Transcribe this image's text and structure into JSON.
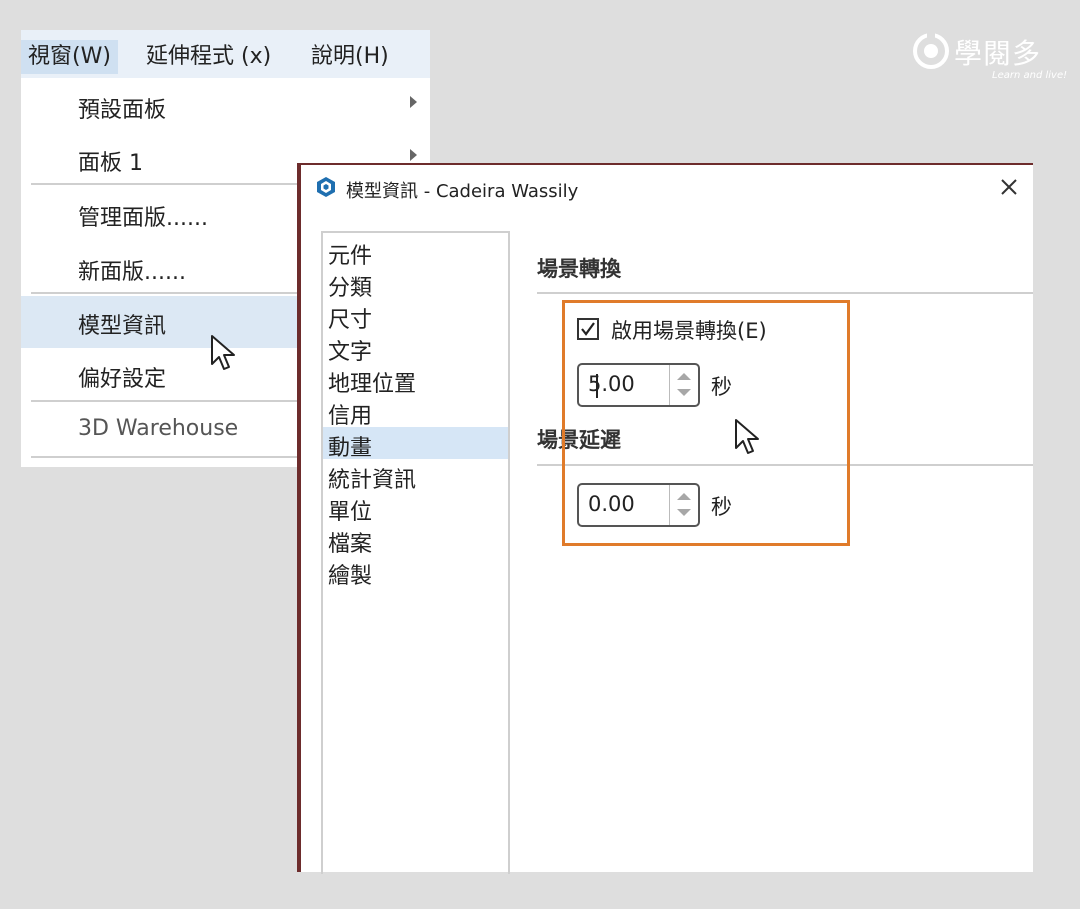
{
  "brand": {
    "name": "學閱多",
    "tagline": "Learn and live!"
  },
  "menubar": {
    "items": [
      "視窗(W)",
      "延伸程式 (x)",
      "說明(H)"
    ]
  },
  "dropdown": {
    "items": [
      {
        "label": "預設面板",
        "submenu": true
      },
      {
        "label": "面板 1",
        "submenu": true
      },
      {
        "label": "管理面版......"
      },
      {
        "label": "新面版......"
      },
      {
        "label": "模型資訊",
        "highlighted": true
      },
      {
        "label": "偏好設定"
      },
      {
        "label": "3D Warehouse"
      }
    ]
  },
  "dialog": {
    "title": "模型資訊 - Cadeira Wassily",
    "sidebar": [
      "元件",
      "分類",
      "尺寸",
      "文字",
      "地理位置",
      "信用",
      "動畫",
      "統計資訊",
      "單位",
      "檔案",
      "繪製"
    ],
    "selected": "動畫",
    "scene_transition": {
      "title": "場景轉換",
      "checkbox_label": "啟用場景轉換(E)",
      "checked": true,
      "value": "5.00",
      "unit": "秒"
    },
    "scene_delay": {
      "title": "場景延遲",
      "value": "0.00",
      "unit": "秒"
    }
  },
  "colors": {
    "highlight": "#e07b2a",
    "selection": "#d6e6f6",
    "dialog_border": "#6d2c2c"
  }
}
